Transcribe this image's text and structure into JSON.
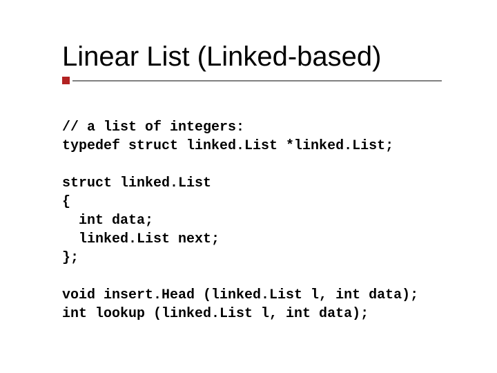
{
  "title": "Linear List (Linked-based)",
  "code": {
    "l1": "// a list of integers:",
    "l2": "typedef struct linked.List *linked.List;",
    "l3": "",
    "l4": "struct linked.List",
    "l5": "{",
    "l6": "  int data;",
    "l7": "  linked.List next;",
    "l8": "};",
    "l9": "",
    "l10": "void insert.Head (linked.List l, int data);",
    "l11": "int lookup (linked.List l, int data);"
  }
}
